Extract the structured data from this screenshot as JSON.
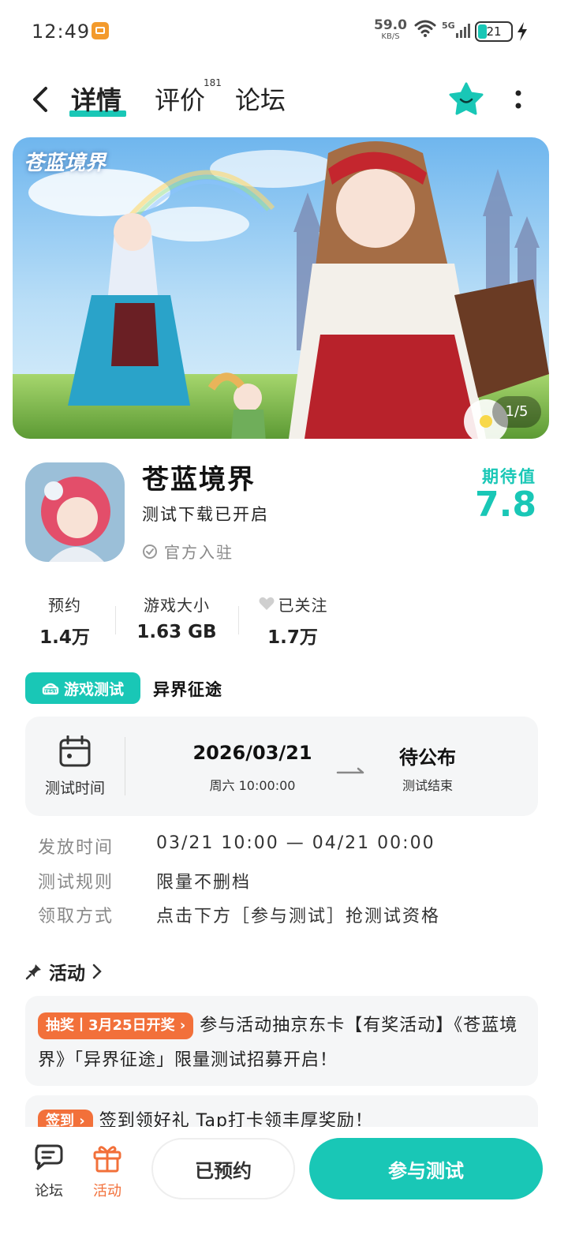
{
  "status_bar": {
    "time": "12:49",
    "net_speed": "59.0",
    "net_unit": "KB/S",
    "network": "5G",
    "battery": "21"
  },
  "nav": {
    "tabs": [
      {
        "label": "详情"
      },
      {
        "label": "评价",
        "count": "181"
      },
      {
        "label": "论坛"
      }
    ]
  },
  "hero": {
    "logo_text": "苍蓝境界",
    "counter": "1/5"
  },
  "game": {
    "title": "苍蓝境界",
    "subtitle": "测试下载已开启",
    "official": "官方入驻",
    "expect_label": "期待值",
    "expect_value": "7.8"
  },
  "stats": [
    {
      "label": "预约",
      "value": "1.4万"
    },
    {
      "label": "游戏大小",
      "value": "1.63 GB"
    },
    {
      "label": "已关注",
      "value": "1.7万"
    }
  ],
  "test": {
    "chip": "游戏测试",
    "name": "异界征途",
    "time_label": "测试时间",
    "start_date": "2026/03/21",
    "start_time": "周六   10:00:00",
    "end_value": "待公布",
    "end_label": "测试结束",
    "rows": [
      {
        "key": "发放时间",
        "value": "03/21 10:00 — 04/21 00:00"
      },
      {
        "key": "测试规则",
        "value": "限量不删档"
      },
      {
        "key": "领取方式",
        "value": "点击下方［参与测试］抢测试资格"
      }
    ]
  },
  "activity": {
    "heading": "活动",
    "items": [
      {
        "badge": "抽奖丨3月25日开奖",
        "text": "参与活动抽京东卡【有奖活动】《苍蓝境界》「异界征途」限量测试招募开启！"
      },
      {
        "badge": "签到",
        "text": "签到领好礼 Tap打卡领丰厚奖励！"
      }
    ]
  },
  "bottom": {
    "forum": "论坛",
    "activity": "活动",
    "reserved": "已预约",
    "join": "参与测试"
  },
  "colors": {
    "accent": "#19c7b6",
    "activity_badge": "#f2703a",
    "bottom_active": "#f2703a"
  }
}
